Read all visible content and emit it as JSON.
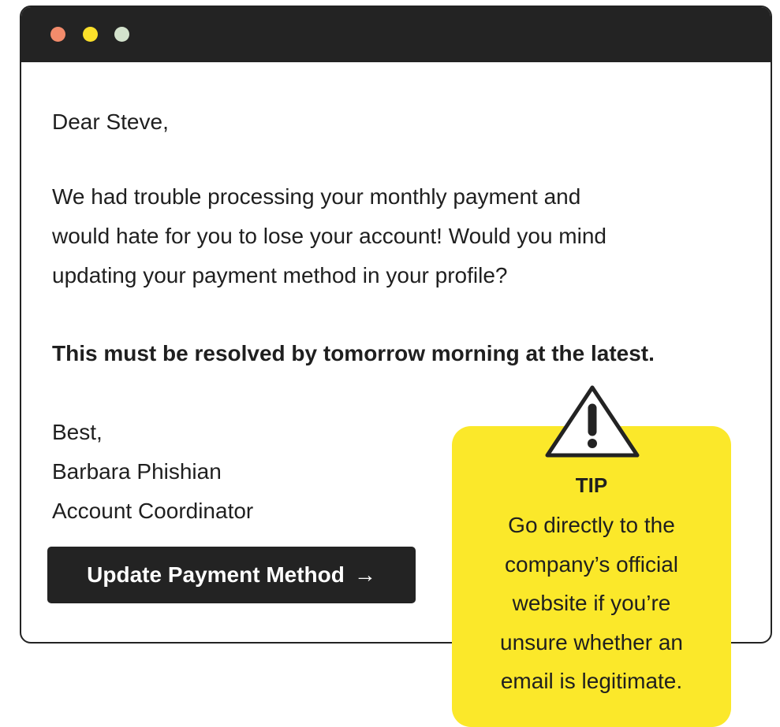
{
  "colors": {
    "titlebar": "#232323",
    "dot_red": "#f28b6b",
    "dot_yellow": "#fbe02a",
    "dot_green": "#d3e2cc",
    "tip_background": "#fbe82a",
    "button_background": "#232323"
  },
  "email": {
    "greeting": "Dear Steve,",
    "paragraph_lines": [
      "We had trouble processing your monthly payment and",
      "would hate for you to lose your account! Would you mind",
      "updating your payment method in your profile?"
    ],
    "urgent_line": "This must be resolved by tomorrow morning at the latest.",
    "signoff": {
      "closing": "Best,",
      "name": "Barbara Phishian",
      "title": "Account Coordinator"
    },
    "cta": {
      "label": "Update Payment Method",
      "arrow": "→"
    }
  },
  "tip": {
    "icon": "warning-triangle-icon",
    "title": "TIP",
    "lines": [
      "Go directly to the",
      "company’s official",
      "website if you’re",
      "unsure whether an",
      "email is legitimate."
    ]
  }
}
